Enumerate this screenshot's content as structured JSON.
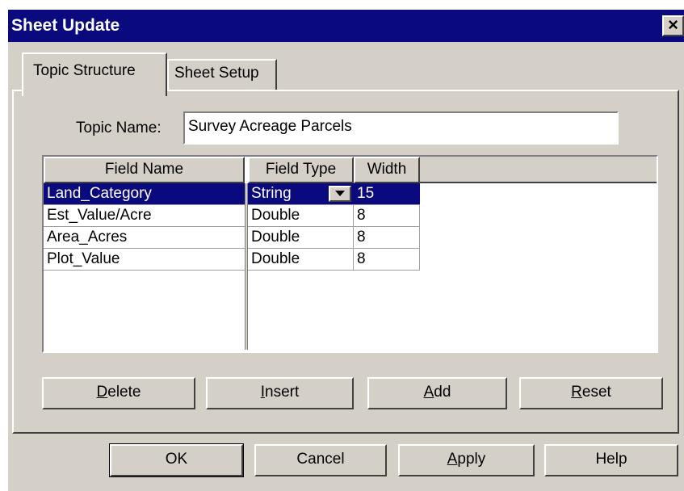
{
  "window": {
    "title": "Sheet Update",
    "close_glyph": "×"
  },
  "tabs": [
    {
      "label": "Topic Structure",
      "active": true
    },
    {
      "label": "Sheet Setup",
      "active": false
    }
  ],
  "topic": {
    "label": "Topic Name:",
    "value": "Survey Acreage Parcels"
  },
  "grid": {
    "headers": {
      "field_name": "Field Name",
      "field_type": "Field Type",
      "width": "Width"
    },
    "field_names": [
      "Land_Category",
      "Est_Value/Acre",
      "Area_Acres",
      "Plot_Value"
    ],
    "rows": [
      {
        "type": "String",
        "width": "15",
        "selected": true,
        "has_dropdown": true
      },
      {
        "type": "Double",
        "width": "8",
        "selected": false
      },
      {
        "type": "Double",
        "width": "8",
        "selected": false
      },
      {
        "type": "Double",
        "width": "8",
        "selected": false
      }
    ]
  },
  "panel_buttons": {
    "delete": "Delete",
    "insert": "Insert",
    "add": "Add",
    "reset": "Reset"
  },
  "dialog_buttons": {
    "ok": "OK",
    "cancel": "Cancel",
    "apply": "Apply",
    "help": "Help"
  },
  "colors": {
    "titlebar": "#0a0a7e",
    "face": "#d4d0c8",
    "selection": "#0a0a7e"
  },
  "icons": {
    "close": "close-icon",
    "dropdown": "chevron-down-icon"
  }
}
